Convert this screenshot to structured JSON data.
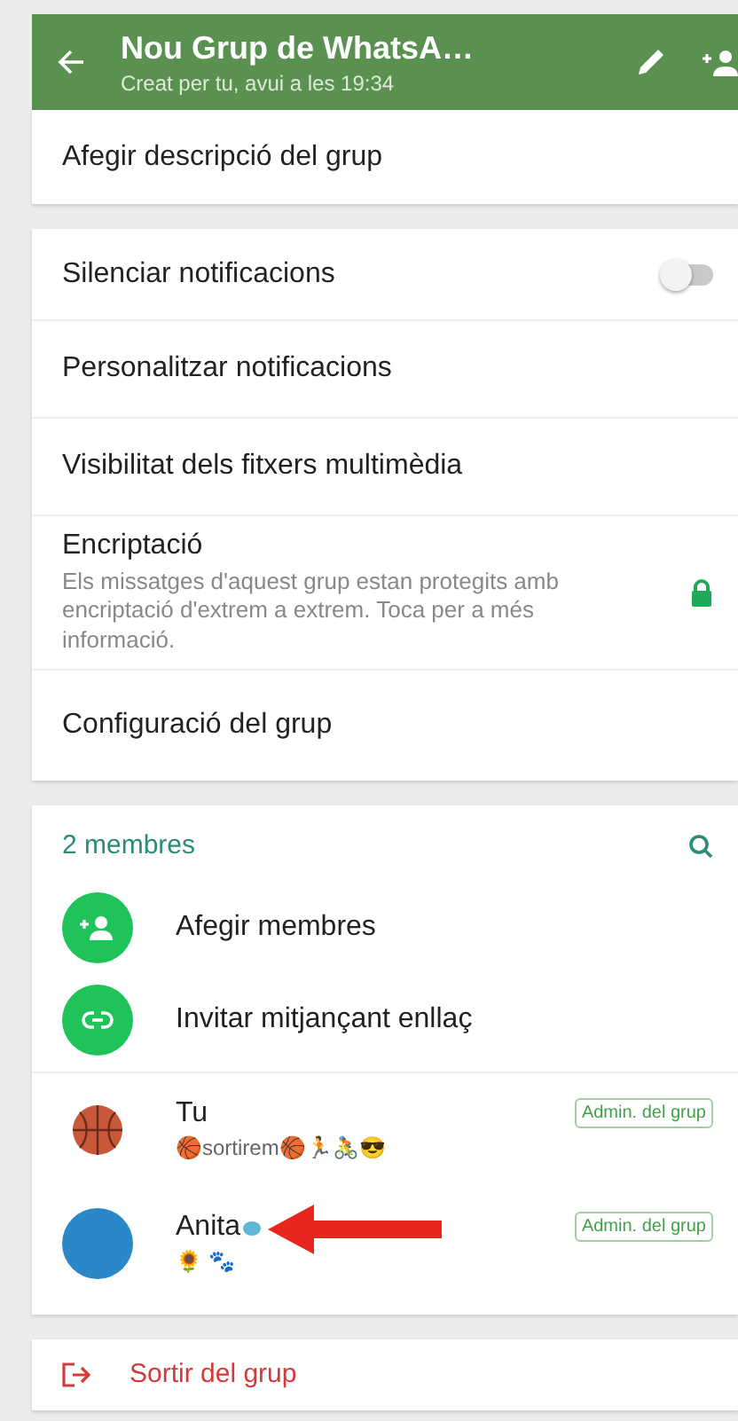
{
  "header": {
    "title": "Nou Grup de WhatsA…",
    "subtitle": "Creat per tu, avui a les 19:34"
  },
  "description": {
    "label": "Afegir descripció del grup"
  },
  "settings": [
    {
      "kind": "toggle",
      "label": "Silenciar notificacions",
      "on": false
    },
    {
      "kind": "plain",
      "label": "Personalitzar notificacions"
    },
    {
      "kind": "plain",
      "label": "Visibilitat dels fitxers multimèdia"
    },
    {
      "kind": "lock",
      "label": "Encriptació",
      "detail": "Els missatges d'aquest grup estan protegits amb encriptació d'extrem a extrem. Toca per a més informació."
    },
    {
      "kind": "plain",
      "label": "Configuració del grup"
    }
  ],
  "members": {
    "count": "2 membres",
    "actions": [
      {
        "kind": "add",
        "label": "Afegir membres"
      },
      {
        "kind": "link",
        "label": "Invitar mitjançant enllaç"
      }
    ],
    "list": [
      {
        "kind": "ball",
        "name": "Tu",
        "status": "🏀sortirem🏀🏃🚴😎",
        "badge": "Admin. del grup",
        "marked": false
      },
      {
        "kind": "plain",
        "name": "Anita",
        "status": "🌻 🐾",
        "badge": "Admin. del grup",
        "marked": true
      }
    ]
  },
  "leave": {
    "label": "Sortir del grup"
  }
}
